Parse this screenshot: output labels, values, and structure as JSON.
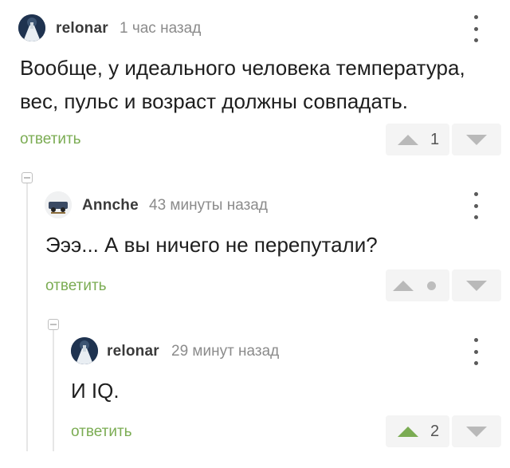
{
  "comments": [
    {
      "username": "relonar",
      "time": "1 час назад",
      "text_lines": [
        "Вообще, у идеального человека температура,",
        "вес, пульс и возраст должны совпадать."
      ],
      "reply_label": "ответить",
      "votes": "1",
      "vote_state": "neutral"
    },
    {
      "username": "Annche",
      "time": "43 минуты назад",
      "text_lines": [
        "Эээ... А вы ничего не перепутали?"
      ],
      "reply_label": "ответить",
      "votes": "",
      "vote_state": "hidden"
    },
    {
      "username": "relonar",
      "time": "29 минут назад",
      "text_lines": [
        "И IQ."
      ],
      "reply_label": "ответить",
      "votes": "2",
      "vote_state": "upvoted"
    }
  ],
  "colors": {
    "accent_green": "#7bac53",
    "vote_gray": "#b9b9b9",
    "vote_bg": "#f4f4f4",
    "thread_line": "#e6e6e6"
  },
  "icons": {
    "menu": "more-vertical-icon",
    "collapse": "minus-square-icon",
    "upvote": "triangle-up-icon",
    "downvote": "triangle-down-icon"
  }
}
